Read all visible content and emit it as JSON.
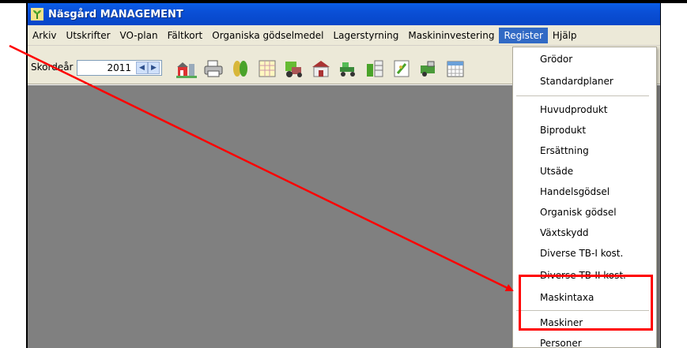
{
  "window": {
    "title": "Näsgård MANAGEMENT"
  },
  "menu": {
    "items": [
      {
        "label": "Arkiv"
      },
      {
        "label": "Utskrifter"
      },
      {
        "label": "VO-plan"
      },
      {
        "label": "Fältkort"
      },
      {
        "label": "Organiska gödselmedel"
      },
      {
        "label": "Lagerstyrning"
      },
      {
        "label": "Maskininvestering"
      },
      {
        "label": "Register"
      },
      {
        "label": "Hjälp"
      }
    ],
    "active_item": "Register"
  },
  "toolbar": {
    "year_label": "Skördeår",
    "year_value": "2011",
    "icons": [
      "farm-icon",
      "printer-icon",
      "crop-icon",
      "field-grid-icon",
      "fertilizer-icon",
      "barn-icon",
      "tractor-icon",
      "storage-icon",
      "seed-icon",
      "machine-icon",
      "calendar-icon"
    ]
  },
  "register_menu": {
    "items": [
      "Grödor",
      "Standardplaner",
      "Huvudprodukt",
      "Biprodukt",
      "Ersättning",
      "Utsäde",
      "Handelsgödsel",
      "Organisk gödsel",
      "Växtskydd",
      "Diverse TB-I kost.",
      "Diverse TB-II kost.",
      "Maskintaxa",
      "Maskiner",
      "Personer"
    ]
  },
  "annotation": {
    "color": "#ff0000"
  }
}
